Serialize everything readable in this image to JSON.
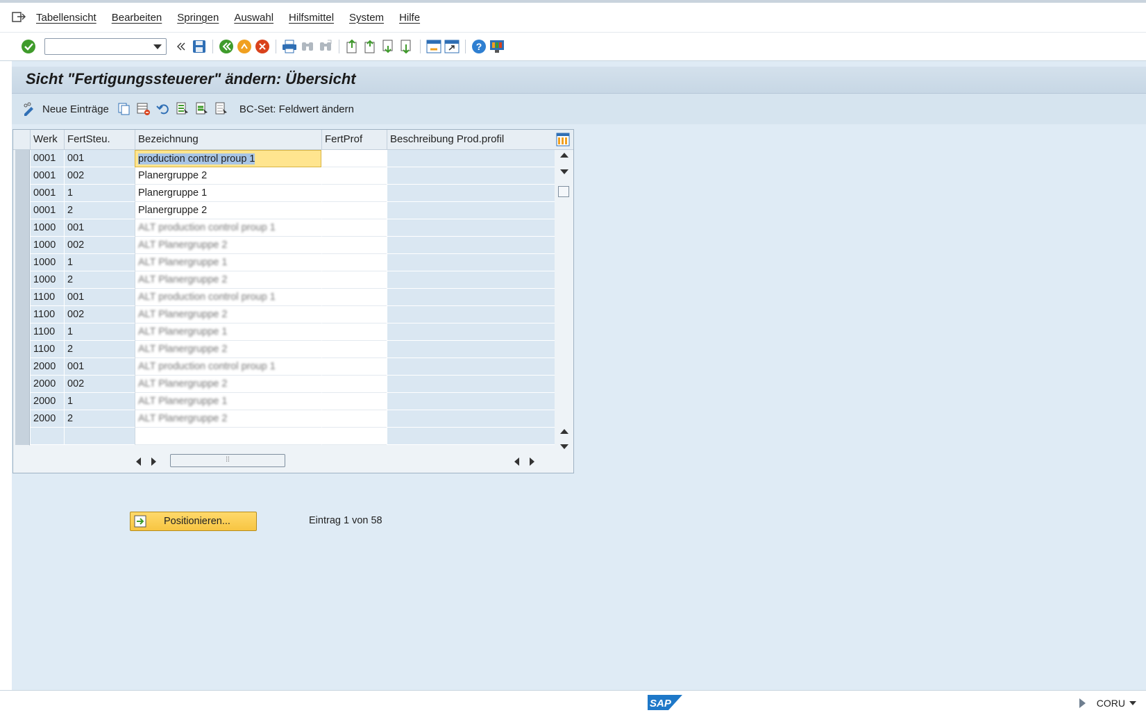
{
  "menu": {
    "items": [
      "Tabellensicht",
      "Bearbeiten",
      "Springen",
      "Auswahl",
      "Hilfsmittel",
      "System",
      "Hilfe"
    ]
  },
  "toolbar": {
    "command_field_value": "",
    "icons": [
      "enter-icon",
      "back-icon",
      "save-icon",
      "back-icon",
      "exit-icon",
      "cancel-icon",
      "print-icon",
      "find-icon",
      "find-next-icon",
      "first-page-icon",
      "previous-page-icon",
      "next-page-icon",
      "last-page-icon",
      "create-session-icon",
      "shortcut-icon",
      "help-icon",
      "customize-layout-icon"
    ]
  },
  "title": "Sicht \"Fertigungssteuerer\" ändern: Übersicht",
  "app_toolbar": {
    "new_entries": "Neue Einträge",
    "bcset": "BC-Set: Feldwert ändern"
  },
  "table": {
    "columns": [
      "Werk",
      "FertSteu.",
      "Bezeichnung",
      "FertProf",
      "Beschreibung Prod.profil"
    ],
    "rows": [
      {
        "werk": "0001",
        "fert": "001",
        "bez": "production control proup 1",
        "prof": "",
        "desc": "",
        "blur": false,
        "active": true
      },
      {
        "werk": "0001",
        "fert": "002",
        "bez": "Planergruppe 2",
        "prof": "",
        "desc": "",
        "blur": false
      },
      {
        "werk": "0001",
        "fert": "1",
        "bez": "Planergruppe 1",
        "prof": "",
        "desc": "",
        "blur": false
      },
      {
        "werk": "0001",
        "fert": "2",
        "bez": "Planergruppe 2",
        "prof": "",
        "desc": "",
        "blur": false
      },
      {
        "werk": "1000",
        "fert": "001",
        "bez": "ALT production control proup 1",
        "prof": "",
        "desc": "",
        "blur": true
      },
      {
        "werk": "1000",
        "fert": "002",
        "bez": "ALT Planergruppe 2",
        "prof": "",
        "desc": "",
        "blur": true
      },
      {
        "werk": "1000",
        "fert": "1",
        "bez": "ALT Planergruppe 1",
        "prof": "",
        "desc": "",
        "blur": true
      },
      {
        "werk": "1000",
        "fert": "2",
        "bez": "ALT Planergruppe 2",
        "prof": "",
        "desc": "",
        "blur": true
      },
      {
        "werk": "1100",
        "fert": "001",
        "bez": "ALT production control proup 1",
        "prof": "",
        "desc": "",
        "blur": true
      },
      {
        "werk": "1100",
        "fert": "002",
        "bez": "ALT Planergruppe 2",
        "prof": "",
        "desc": "",
        "blur": true
      },
      {
        "werk": "1100",
        "fert": "1",
        "bez": "ALT Planergruppe 1",
        "prof": "",
        "desc": "",
        "blur": true
      },
      {
        "werk": "1100",
        "fert": "2",
        "bez": "ALT Planergruppe 2",
        "prof": "",
        "desc": "",
        "blur": true
      },
      {
        "werk": "2000",
        "fert": "001",
        "bez": "ALT production control proup 1",
        "prof": "",
        "desc": "",
        "blur": true
      },
      {
        "werk": "2000",
        "fert": "002",
        "bez": "ALT Planergruppe 2",
        "prof": "",
        "desc": "",
        "blur": true
      },
      {
        "werk": "2000",
        "fert": "1",
        "bez": "ALT Planergruppe 1",
        "prof": "",
        "desc": "",
        "blur": true
      },
      {
        "werk": "2000",
        "fert": "2",
        "bez": "ALT Planergruppe 2",
        "prof": "",
        "desc": "",
        "blur": true
      },
      {
        "werk": "",
        "fert": "",
        "bez": "",
        "prof": "",
        "desc": "",
        "blur": false
      }
    ]
  },
  "position_button": "Positionieren...",
  "entry_info": "Eintrag 1 von 58",
  "status": {
    "system_id": "CORU",
    "logo_text": "SAP"
  },
  "colors": {
    "accent_yellow": "#f7c542",
    "header_blue": "#c7d7e5",
    "background": "#dfebf5"
  }
}
